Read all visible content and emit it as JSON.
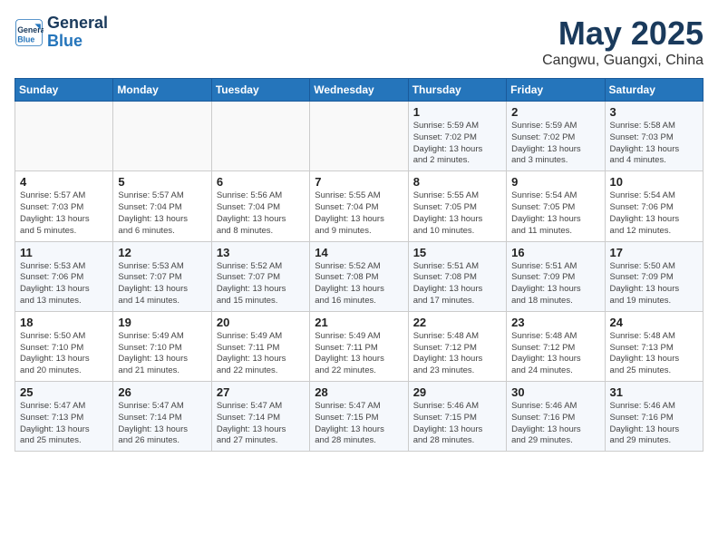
{
  "logo": {
    "line1": "General",
    "line2": "Blue"
  },
  "header": {
    "month": "May 2025",
    "location": "Cangwu, Guangxi, China"
  },
  "days_of_week": [
    "Sunday",
    "Monday",
    "Tuesday",
    "Wednesday",
    "Thursday",
    "Friday",
    "Saturday"
  ],
  "weeks": [
    [
      {
        "day": "",
        "info": ""
      },
      {
        "day": "",
        "info": ""
      },
      {
        "day": "",
        "info": ""
      },
      {
        "day": "",
        "info": ""
      },
      {
        "day": "1",
        "info": "Sunrise: 5:59 AM\nSunset: 7:02 PM\nDaylight: 13 hours\nand 2 minutes."
      },
      {
        "day": "2",
        "info": "Sunrise: 5:59 AM\nSunset: 7:02 PM\nDaylight: 13 hours\nand 3 minutes."
      },
      {
        "day": "3",
        "info": "Sunrise: 5:58 AM\nSunset: 7:03 PM\nDaylight: 13 hours\nand 4 minutes."
      }
    ],
    [
      {
        "day": "4",
        "info": "Sunrise: 5:57 AM\nSunset: 7:03 PM\nDaylight: 13 hours\nand 5 minutes."
      },
      {
        "day": "5",
        "info": "Sunrise: 5:57 AM\nSunset: 7:04 PM\nDaylight: 13 hours\nand 6 minutes."
      },
      {
        "day": "6",
        "info": "Sunrise: 5:56 AM\nSunset: 7:04 PM\nDaylight: 13 hours\nand 8 minutes."
      },
      {
        "day": "7",
        "info": "Sunrise: 5:55 AM\nSunset: 7:04 PM\nDaylight: 13 hours\nand 9 minutes."
      },
      {
        "day": "8",
        "info": "Sunrise: 5:55 AM\nSunset: 7:05 PM\nDaylight: 13 hours\nand 10 minutes."
      },
      {
        "day": "9",
        "info": "Sunrise: 5:54 AM\nSunset: 7:05 PM\nDaylight: 13 hours\nand 11 minutes."
      },
      {
        "day": "10",
        "info": "Sunrise: 5:54 AM\nSunset: 7:06 PM\nDaylight: 13 hours\nand 12 minutes."
      }
    ],
    [
      {
        "day": "11",
        "info": "Sunrise: 5:53 AM\nSunset: 7:06 PM\nDaylight: 13 hours\nand 13 minutes."
      },
      {
        "day": "12",
        "info": "Sunrise: 5:53 AM\nSunset: 7:07 PM\nDaylight: 13 hours\nand 14 minutes."
      },
      {
        "day": "13",
        "info": "Sunrise: 5:52 AM\nSunset: 7:07 PM\nDaylight: 13 hours\nand 15 minutes."
      },
      {
        "day": "14",
        "info": "Sunrise: 5:52 AM\nSunset: 7:08 PM\nDaylight: 13 hours\nand 16 minutes."
      },
      {
        "day": "15",
        "info": "Sunrise: 5:51 AM\nSunset: 7:08 PM\nDaylight: 13 hours\nand 17 minutes."
      },
      {
        "day": "16",
        "info": "Sunrise: 5:51 AM\nSunset: 7:09 PM\nDaylight: 13 hours\nand 18 minutes."
      },
      {
        "day": "17",
        "info": "Sunrise: 5:50 AM\nSunset: 7:09 PM\nDaylight: 13 hours\nand 19 minutes."
      }
    ],
    [
      {
        "day": "18",
        "info": "Sunrise: 5:50 AM\nSunset: 7:10 PM\nDaylight: 13 hours\nand 20 minutes."
      },
      {
        "day": "19",
        "info": "Sunrise: 5:49 AM\nSunset: 7:10 PM\nDaylight: 13 hours\nand 21 minutes."
      },
      {
        "day": "20",
        "info": "Sunrise: 5:49 AM\nSunset: 7:11 PM\nDaylight: 13 hours\nand 22 minutes."
      },
      {
        "day": "21",
        "info": "Sunrise: 5:49 AM\nSunset: 7:11 PM\nDaylight: 13 hours\nand 22 minutes."
      },
      {
        "day": "22",
        "info": "Sunrise: 5:48 AM\nSunset: 7:12 PM\nDaylight: 13 hours\nand 23 minutes."
      },
      {
        "day": "23",
        "info": "Sunrise: 5:48 AM\nSunset: 7:12 PM\nDaylight: 13 hours\nand 24 minutes."
      },
      {
        "day": "24",
        "info": "Sunrise: 5:48 AM\nSunset: 7:13 PM\nDaylight: 13 hours\nand 25 minutes."
      }
    ],
    [
      {
        "day": "25",
        "info": "Sunrise: 5:47 AM\nSunset: 7:13 PM\nDaylight: 13 hours\nand 25 minutes."
      },
      {
        "day": "26",
        "info": "Sunrise: 5:47 AM\nSunset: 7:14 PM\nDaylight: 13 hours\nand 26 minutes."
      },
      {
        "day": "27",
        "info": "Sunrise: 5:47 AM\nSunset: 7:14 PM\nDaylight: 13 hours\nand 27 minutes."
      },
      {
        "day": "28",
        "info": "Sunrise: 5:47 AM\nSunset: 7:15 PM\nDaylight: 13 hours\nand 28 minutes."
      },
      {
        "day": "29",
        "info": "Sunrise: 5:46 AM\nSunset: 7:15 PM\nDaylight: 13 hours\nand 28 minutes."
      },
      {
        "day": "30",
        "info": "Sunrise: 5:46 AM\nSunset: 7:16 PM\nDaylight: 13 hours\nand 29 minutes."
      },
      {
        "day": "31",
        "info": "Sunrise: 5:46 AM\nSunset: 7:16 PM\nDaylight: 13 hours\nand 29 minutes."
      }
    ]
  ]
}
